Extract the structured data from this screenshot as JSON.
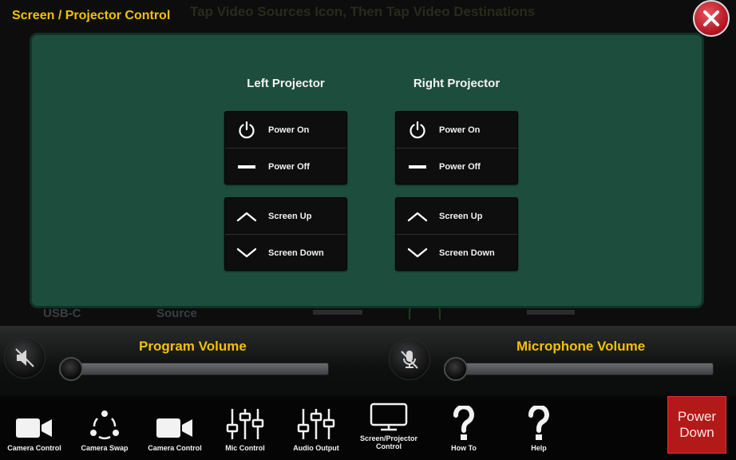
{
  "background": {
    "hint": "Tap Video Sources Icon, Then Tap Video Destinations",
    "labels": [
      "USB-C",
      "Source"
    ]
  },
  "popup": {
    "title": "Screen / Projector Control",
    "close_icon": "close-x-icon",
    "columns": [
      {
        "title": "Left Projector",
        "power_on": "Power On",
        "power_off": "Power Off",
        "screen_up": "Screen Up",
        "screen_down": "Screen Down"
      },
      {
        "title": "Right Projector",
        "power_on": "Power On",
        "power_off": "Power Off",
        "screen_up": "Screen Up",
        "screen_down": "Screen Down"
      }
    ]
  },
  "volume": {
    "program": {
      "label": "Program Volume",
      "level": 0.0,
      "icon": "speaker-muted-icon"
    },
    "microphone": {
      "label": "Microphone Volume",
      "level": 0.0,
      "icon": "microphone-muted-icon"
    }
  },
  "nav": {
    "items": [
      {
        "label": "Camera Control",
        "icon": "video-camera-icon"
      },
      {
        "label": "Camera Swap",
        "icon": "swap-cycle-icon"
      },
      {
        "label": "Camera Control",
        "icon": "video-camera-icon"
      },
      {
        "label": "Mic Control",
        "icon": "mixer-faders-icon"
      },
      {
        "label": "Audio Output",
        "icon": "mixer-faders-icon"
      },
      {
        "label": "Screen/Projector Control",
        "icon": "monitor-icon"
      },
      {
        "label": "How To",
        "icon": "question-icon"
      },
      {
        "label": "Help",
        "icon": "question-icon"
      }
    ],
    "power": {
      "line1": "Power",
      "line2": "Down"
    }
  },
  "colors": {
    "accent": "#f2c100",
    "panel": "#1d4e3d",
    "power": "#b21a1a",
    "close": "#c8141f"
  }
}
